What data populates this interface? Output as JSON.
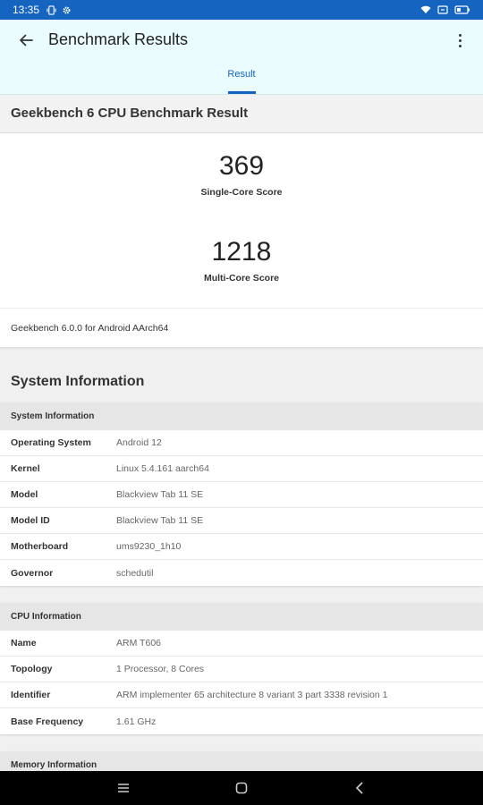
{
  "status_bar": {
    "time": "13:35"
  },
  "app_bar": {
    "title": "Benchmark Results",
    "tab": "Result"
  },
  "result": {
    "title": "Geekbench 6 CPU Benchmark Result",
    "single_core": {
      "score": "369",
      "label": "Single-Core Score"
    },
    "multi_core": {
      "score": "1218",
      "label": "Multi-Core Score"
    },
    "version": "Geekbench 6.0.0 for Android AArch64"
  },
  "system": {
    "section_title": "System Information",
    "system_table": {
      "header": "System Information",
      "rows": [
        {
          "key": "Operating System",
          "value": "Android 12"
        },
        {
          "key": "Kernel",
          "value": "Linux 5.4.161 aarch64"
        },
        {
          "key": "Model",
          "value": "Blackview Tab 11 SE"
        },
        {
          "key": "Model ID",
          "value": "Blackview Tab 11 SE"
        },
        {
          "key": "Motherboard",
          "value": "ums9230_1h10"
        },
        {
          "key": "Governor",
          "value": "schedutil"
        }
      ]
    },
    "cpu_table": {
      "header": "CPU Information",
      "rows": [
        {
          "key": "Name",
          "value": "ARM T606"
        },
        {
          "key": "Topology",
          "value": "1 Processor, 8 Cores"
        },
        {
          "key": "Identifier",
          "value": "ARM implementer 65 architecture 8 variant 3 part 3338 revision 1"
        },
        {
          "key": "Base Frequency",
          "value": "1.61 GHz"
        }
      ]
    },
    "memory_table": {
      "header": "Memory Information"
    }
  },
  "icons": {
    "back": "arrow-left-icon",
    "more": "more-vert-icon",
    "nav": [
      "recents-icon",
      "home-icon",
      "back-nav-icon"
    ]
  },
  "colors": {
    "accent": "#1565c0",
    "appbar_bg": "#eafcfd",
    "status_bar": "#1565c0"
  }
}
